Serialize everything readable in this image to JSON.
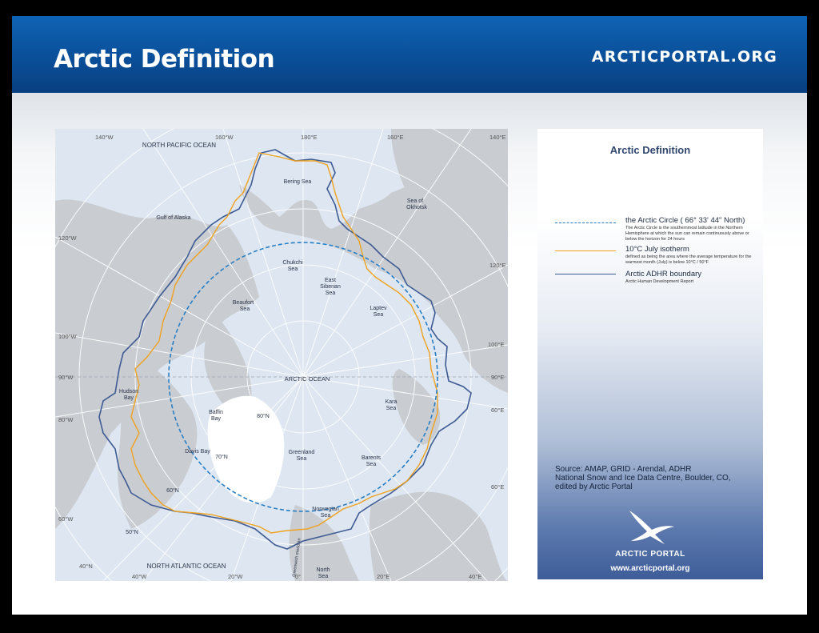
{
  "header": {
    "title": "Arctic Definition",
    "brand": "ARCTICPORTAL.ORG"
  },
  "map": {
    "longitude_labels": [
      "140°W",
      "160°W",
      "180°E",
      "160°E",
      "140°E",
      "120°W",
      "120°E",
      "100°W",
      "100°E",
      "90°W",
      "90°E",
      "80°W",
      "60°E",
      "60°W",
      "60°E",
      "40°N",
      "40°W",
      "20°W",
      "0°",
      "20°E",
      "40°E"
    ],
    "place_labels": {
      "north_pacific": "NORTH PACIFIC OCEAN",
      "bering": "Bering Sea",
      "okhotsk_1": "Sea of",
      "okhotsk_2": "Okhotsk",
      "gulf_alaska": "Gulf of Alaska",
      "chukchi_1": "Chukchi",
      "chukchi_2": "Sea",
      "east_siberian_1": "East",
      "east_siberian_2": "Siberian",
      "east_siberian_3": "Sea",
      "beaufort_1": "Beaufort",
      "beaufort_2": "Sea",
      "laptev_1": "Laptev",
      "laptev_2": "Sea",
      "arctic_ocean": "ARCTIC OCEAN",
      "hudson_1": "Hudson",
      "hudson_2": "Bay",
      "baffin_1": "Baffin",
      "baffin_2": "Bay",
      "kara_1": "Kara",
      "kara_2": "Sea",
      "lat80": "80°N",
      "lat70": "70°N",
      "lat60": "60°N",
      "lat50": "50°N",
      "davis": "Davis Bay",
      "greenland_1": "Greenland",
      "greenland_2": "Sea",
      "barents_1": "Barents",
      "barents_2": "Sea",
      "norwegian_1": "Norwegian",
      "norwegian_2": "Sea",
      "north_atlantic": "NORTH ATLANTIC OCEAN",
      "north_sea_1": "North",
      "north_sea_2": "Sea",
      "greenwich": "Greenwich meridian"
    },
    "colors": {
      "ocean": "#dde6f1",
      "land": "#c9ccd1",
      "ice": "#ffffff",
      "arctic_circle": "#2a7fc4",
      "isotherm": "#f0a21e",
      "adhr": "#3e5b93"
    }
  },
  "legend": {
    "title": "Arctic Definition",
    "items": [
      {
        "label": "the Arctic Circle ( 66° 33' 44\"  North)",
        "desc": "The Arctic Circle is the southernmost latitude in the Northern Hemisphere at which the sun can remain continuously above or below the horizon for 24 hours"
      },
      {
        "label": "10°C July isotherm",
        "desc": "defined as being the area where the average temperature for the warmest month (July) is below 10°C / 50°F"
      },
      {
        "label": "Arctic ADHR boundary",
        "desc": "Arctic Human Development Report"
      }
    ],
    "source_1": "Source: AMAP, GRID - Arendal, ADHR",
    "source_2": "National Snow and Ice Data Centre, Boulder, CO,",
    "source_3": "edited by Arctic Portal",
    "logo_name": "ARCTIC PORTAL",
    "url": "www.arcticportal.org"
  }
}
